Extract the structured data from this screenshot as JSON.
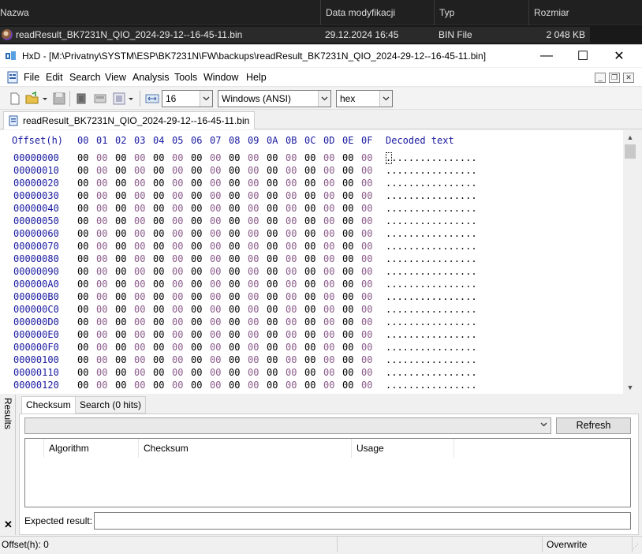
{
  "explorer": {
    "columns": [
      "Nazwa",
      "Data modyfikacji",
      "Typ",
      "Rozmiar"
    ],
    "file": {
      "name": "readResult_BK7231N_QIO_2024-29-12--16-45-11.bin",
      "modified": "29.12.2024 16:45",
      "type": "BIN File",
      "size": "2 048 KB"
    }
  },
  "window": {
    "title": "HxD - [M:\\Privatny\\SYSTM\\ESP\\BK7231N\\FW\\backups\\readResult_BK7231N_QIO_2024-29-12--16-45-11.bin]",
    "minimize": "—",
    "maximize": "☐",
    "close": "✕"
  },
  "menu": [
    "File",
    "Edit",
    "Search",
    "View",
    "Analysis",
    "Tools",
    "Window",
    "Help"
  ],
  "toolbar": {
    "bytes_per_row": "16",
    "charset": "Windows (ANSI)",
    "offset_base": "hex"
  },
  "doc_tab": "readResult_BK7231N_QIO_2024-29-12--16-45-11.bin",
  "hex": {
    "offset_header": "Offset(h)",
    "columns": [
      "00",
      "01",
      "02",
      "03",
      "04",
      "05",
      "06",
      "07",
      "08",
      "09",
      "0A",
      "0B",
      "0C",
      "0D",
      "0E",
      "0F"
    ],
    "decoded_header": "Decoded text",
    "byte_value": "00",
    "decoded_row": "................",
    "offsets": [
      "00000000",
      "00000010",
      "00000020",
      "00000030",
      "00000040",
      "00000050",
      "00000060",
      "00000070",
      "00000080",
      "00000090",
      "000000A0",
      "000000B0",
      "000000C0",
      "000000D0",
      "000000E0",
      "000000F0",
      "00000100",
      "00000110",
      "00000120"
    ]
  },
  "results": {
    "side_label": "Results",
    "close": "✕",
    "tabs": [
      "Checksum",
      "Search (0 hits)"
    ],
    "refresh": "Refresh",
    "list_columns": [
      "Algorithm",
      "Checksum",
      "Usage"
    ],
    "expected_label": "Expected result:"
  },
  "status": {
    "offset": "Offset(h): 0",
    "mode": "Overwrite"
  },
  "colors": {
    "offset_blue": "#1a1aa0",
    "odd_byte": "#8a5a8a"
  }
}
